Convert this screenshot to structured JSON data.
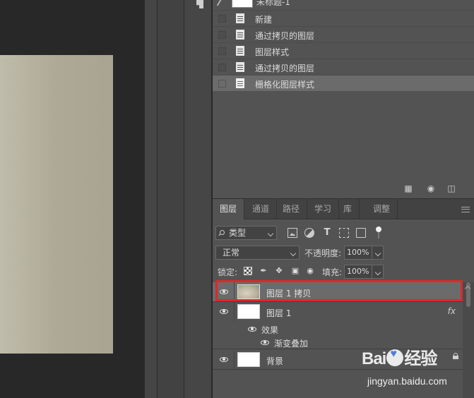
{
  "history": {
    "snapshot_label": "未标题-1",
    "items": [
      {
        "label": "新建",
        "selected": false
      },
      {
        "label": "通过拷贝的图层",
        "selected": false
      },
      {
        "label": "图层样式",
        "selected": false
      },
      {
        "label": "通过拷贝的图层",
        "selected": false
      },
      {
        "label": "栅格化图层样式",
        "selected": true
      }
    ],
    "footer_icons": [
      "new-document-from-state-icon",
      "camera-icon",
      "trash-icon"
    ]
  },
  "layers_panel": {
    "tabs": [
      {
        "label": "图层",
        "active": true
      },
      {
        "label": "通道",
        "active": false
      },
      {
        "label": "路径",
        "active": false
      },
      {
        "label": "学习",
        "active": false
      },
      {
        "label": "库",
        "active": false
      },
      {
        "label": "调整",
        "active": false
      }
    ],
    "filter": {
      "label": "类型"
    },
    "blend_mode": "正常",
    "opacity_label": "不透明度:",
    "opacity_value": "100%",
    "lock_label": "锁定:",
    "fill_label": "填充:",
    "fill_value": "100%",
    "layers": [
      {
        "name": "图层 1 拷贝",
        "selected": true,
        "thumb": "gradient"
      },
      {
        "name": "图层 1",
        "selected": false,
        "thumb": "white",
        "fx": "fx"
      },
      {
        "name": "背景",
        "selected": false,
        "thumb": "white",
        "locked": true
      }
    ],
    "effects_label": "效果",
    "effect_item": "渐变叠加"
  },
  "colors": {
    "panel_bg": "#535353",
    "selected_bg": "#6b6b6b",
    "highlight": "#e0262c",
    "canvas_image": "#aea996"
  },
  "watermark": {
    "logo": "Bai经验",
    "logo_prefix": "Bai",
    "logo_suffix": "经验",
    "url": "jingyan.baidu.com"
  }
}
